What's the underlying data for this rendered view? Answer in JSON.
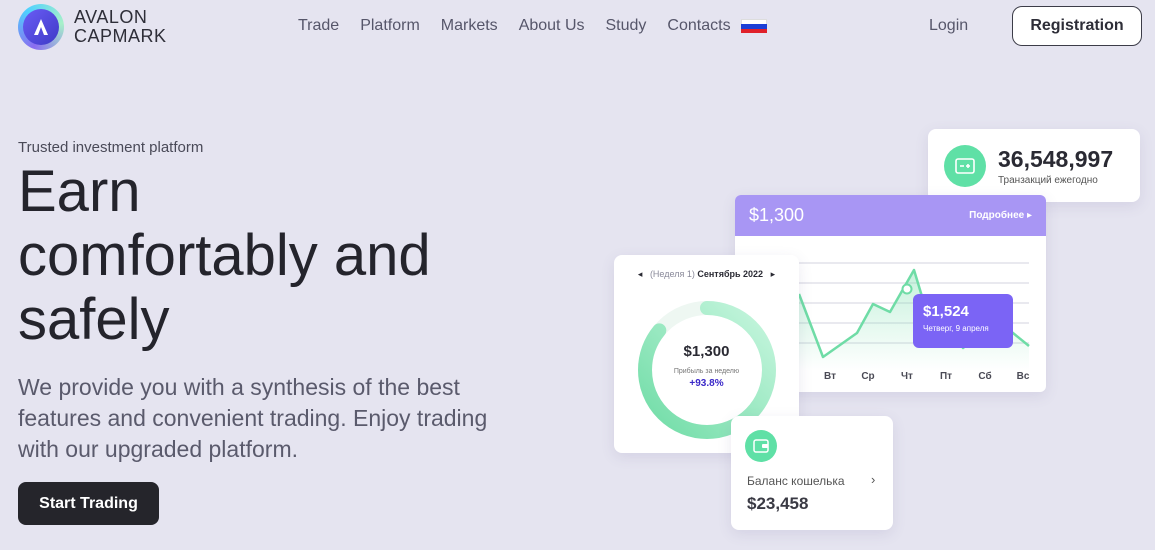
{
  "brand": {
    "line1": "AVALON",
    "line2": "CAPMARK",
    "logo_letter": "A"
  },
  "nav": {
    "items": [
      "Trade",
      "Platform",
      "Markets",
      "About Us",
      "Study",
      "Contacts"
    ],
    "language_icon": "russian-flag-icon"
  },
  "header": {
    "login": "Login",
    "register": "Registration"
  },
  "hero": {
    "eyebrow": "Trusted investment platform",
    "title": "Earn comfortably and safely",
    "subtitle": "We provide you with a synthesis of the best features and convenient trading. Enjoy trading with our upgraded platform.",
    "cta": "Start Trading"
  },
  "transactions_card": {
    "value": "36,548,997",
    "label": "Транзакций ежегодно"
  },
  "chart_card": {
    "amount": "$1,300",
    "more": "Подробнее ▸",
    "days": [
      "Вт",
      "Ср",
      "Чт",
      "Пт",
      "Сб",
      "Вс"
    ],
    "tooltip_value": "$1,524",
    "tooltip_date": "Четверг, 9 апреля"
  },
  "week_card": {
    "prev": "◂",
    "period_muted": "(Неделя 1)",
    "period": "Сентябрь 2022",
    "next": "▸",
    "amount": "$1,300",
    "label": "Прибыль за неделю",
    "change": "+93.8%",
    "progress_fraction": 0.86
  },
  "wallet_card": {
    "label": "Баланс кошелька",
    "chevron": "›",
    "value": "$23,458"
  },
  "colors": {
    "accent_purple": "#7b64f5",
    "accent_green": "#5fe0a6",
    "background": "#e5e4f0"
  }
}
